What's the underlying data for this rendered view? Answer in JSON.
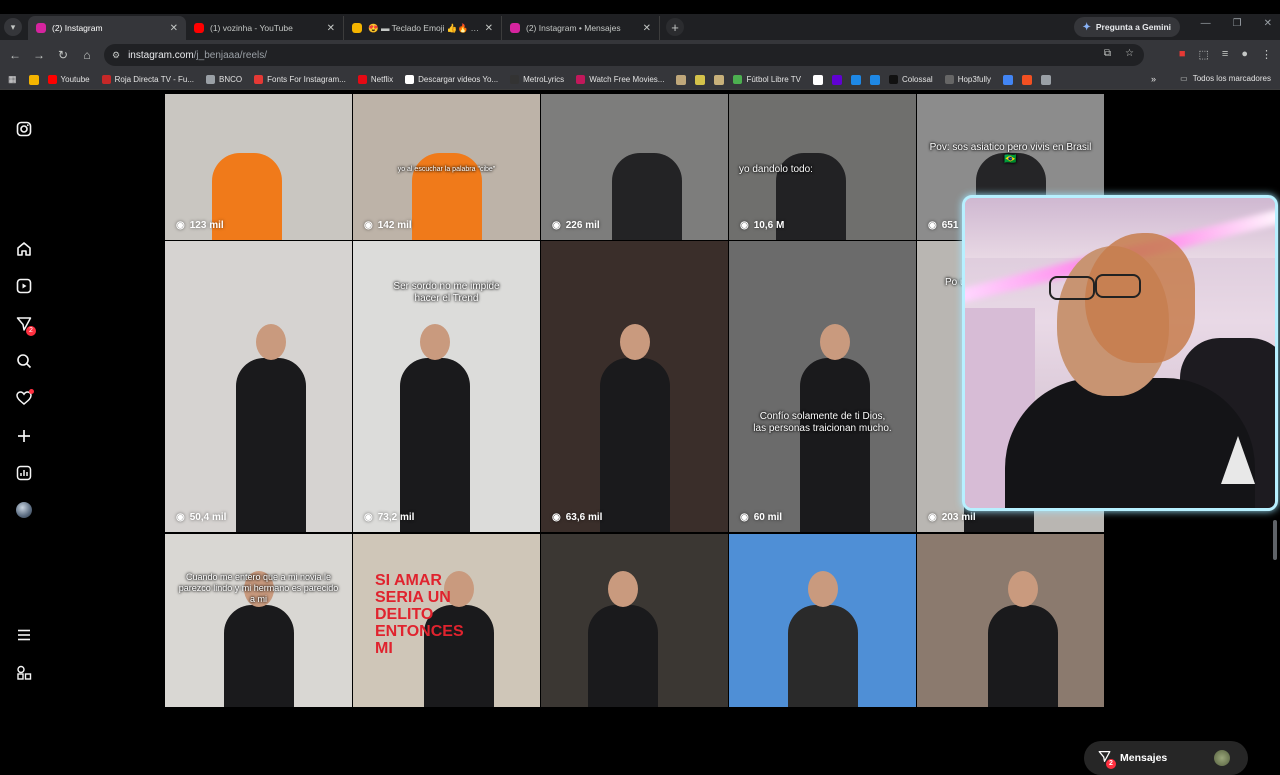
{
  "browser": {
    "tabs": [
      {
        "title": "(2) Instagram",
        "active": true,
        "favicon_color": "#d6249f"
      },
      {
        "title": "(1) vozinha - YouTube",
        "active": false,
        "favicon_color": "#ff0000"
      },
      {
        "title": "😍 ▬ Teclado Emoji 👍🔥 39%",
        "active": false,
        "favicon_color": "#f4b400"
      },
      {
        "title": "(2) Instagram • Mensajes",
        "active": false,
        "favicon_color": "#d6249f"
      }
    ],
    "gemini_label": "Pregunta a Gemini",
    "url_host": "instagram.com",
    "url_path": "/j_benjaaa/reels/",
    "bookmarks": [
      {
        "label": "",
        "color": "#f4b400"
      },
      {
        "label": "Youtube",
        "color": "#ff0000"
      },
      {
        "label": "Roja Directa TV - Fu...",
        "color": "#c62828"
      },
      {
        "label": "BNCO",
        "color": "#9aa0a6"
      },
      {
        "label": "Fonts For Instagram...",
        "color": "#e53935"
      },
      {
        "label": "Netflix",
        "color": "#e50914"
      },
      {
        "label": "Descargar videos Yo...",
        "color": "#ffffff"
      },
      {
        "label": "MetroLyrics",
        "color": "#333333"
      },
      {
        "label": "Watch Free Movies...",
        "color": "#c2185b"
      },
      {
        "label": "",
        "color": "#bfa77a"
      },
      {
        "label": "",
        "color": "#d4c24a"
      },
      {
        "label": "",
        "color": "#c7b07a"
      },
      {
        "label": "Fútbol Libre TV",
        "color": "#4caf50"
      },
      {
        "label": "",
        "color": "#ffffff"
      },
      {
        "label": "",
        "color": "#6001d2"
      },
      {
        "label": "",
        "color": "#1e88e5"
      },
      {
        "label": "",
        "color": "#1e88e5"
      },
      {
        "label": "Colossal",
        "color": "#111111"
      },
      {
        "label": "Hop3fully",
        "color": "#666666"
      },
      {
        "label": "",
        "color": "#4285f4"
      },
      {
        "label": "",
        "color": "#f25022"
      },
      {
        "label": "",
        "color": "#9aa0a6"
      }
    ],
    "all_bookmarks_label": "Todos los marcadores"
  },
  "sidebar": {
    "items": [
      {
        "name": "instagram-logo-icon"
      },
      {
        "name": "home-icon"
      },
      {
        "name": "reels-icon"
      },
      {
        "name": "messages-icon",
        "badge": "2"
      },
      {
        "name": "search-icon"
      },
      {
        "name": "notifications-icon"
      },
      {
        "name": "create-icon"
      },
      {
        "name": "dashboard-icon"
      },
      {
        "name": "profile-avatar"
      },
      {
        "name": "menu-icon"
      },
      {
        "name": "more-apps-icon"
      }
    ]
  },
  "reels": [
    {
      "views": "123 mil",
      "caption": "",
      "bg": "#c9c6c1"
    },
    {
      "views": "142 mil",
      "caption": "yo al escuchar la palabra \"cibe\"",
      "bg": "#bdb3a8"
    },
    {
      "views": "226 mil",
      "caption": "",
      "bg": "#7d7d7c"
    },
    {
      "views": "10,6 M",
      "caption": "yo dandolo todo:",
      "bg": "#6f6f6d"
    },
    {
      "views": "651",
      "caption": "Pov: sos asiatico pero vivis en Brasil 🇧🇷",
      "bg": "#8c8c8c"
    },
    {
      "views": "50,4 mil",
      "caption": "",
      "bg": "#d6d3d1"
    },
    {
      "views": "73,2 mil",
      "caption": "Ser sordo no me impide hacer el Trend",
      "bg": "#dcdcda"
    },
    {
      "views": "63,6 mil",
      "caption": "",
      "bg": "#3a2e2a"
    },
    {
      "views": "60 mil",
      "caption": "Confío solamente de ti Dios, las personas traicionan mucho.",
      "bg": "#6b6b6b"
    },
    {
      "views": "203 mil",
      "caption": "Po u",
      "bg": "#b9b6b2"
    },
    {
      "views": "",
      "caption": "Cuando me entero que a mi novia le parezco lindo y mi hermano es parecido a mi",
      "bg": "#d9d7d3"
    },
    {
      "views": "",
      "caption": "SI AMAR SERIA UN DELITO ENTONCES MI",
      "bg": "#cfc6b8"
    },
    {
      "views": "",
      "caption": "",
      "bg": "#3b3733"
    },
    {
      "views": "",
      "caption": "",
      "bg": "#4f8fd6"
    },
    {
      "views": "",
      "caption": "",
      "bg": "#8b7a6e"
    }
  ],
  "messages_bar": {
    "label": "Mensajes",
    "badge": "2"
  }
}
